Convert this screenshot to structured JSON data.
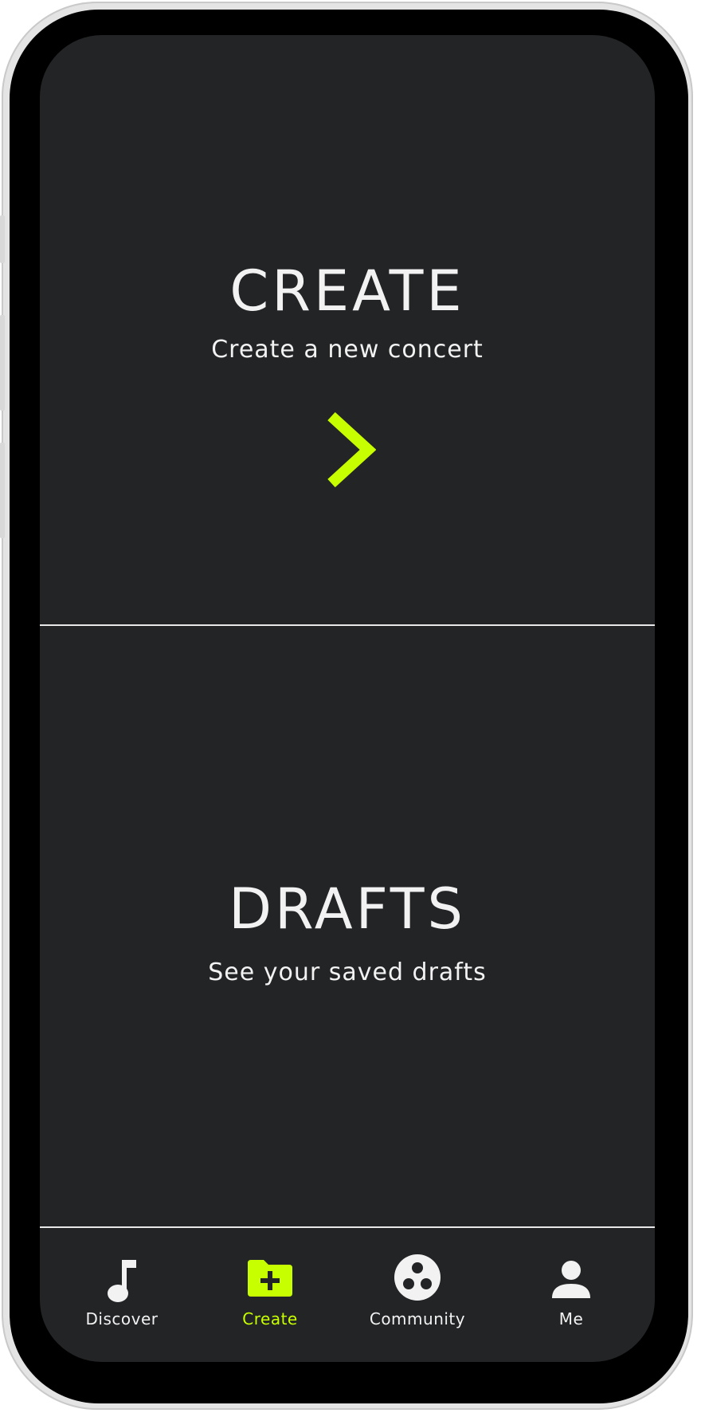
{
  "theme": {
    "accent": "#c8ff00",
    "background": "#232426",
    "text": "#f2f2f2"
  },
  "create": {
    "title": "CREATE",
    "subtitle": "Create a new concert",
    "icon": "chevron-right-icon"
  },
  "drafts": {
    "title": "DRAFTS",
    "subtitle": "See your saved drafts"
  },
  "nav": {
    "active": "Create",
    "items": [
      {
        "label": "Discover",
        "icon": "music-note-icon"
      },
      {
        "label": "Create",
        "icon": "folder-plus-icon"
      },
      {
        "label": "Community",
        "icon": "community-icon"
      },
      {
        "label": "Me",
        "icon": "person-icon"
      }
    ]
  }
}
